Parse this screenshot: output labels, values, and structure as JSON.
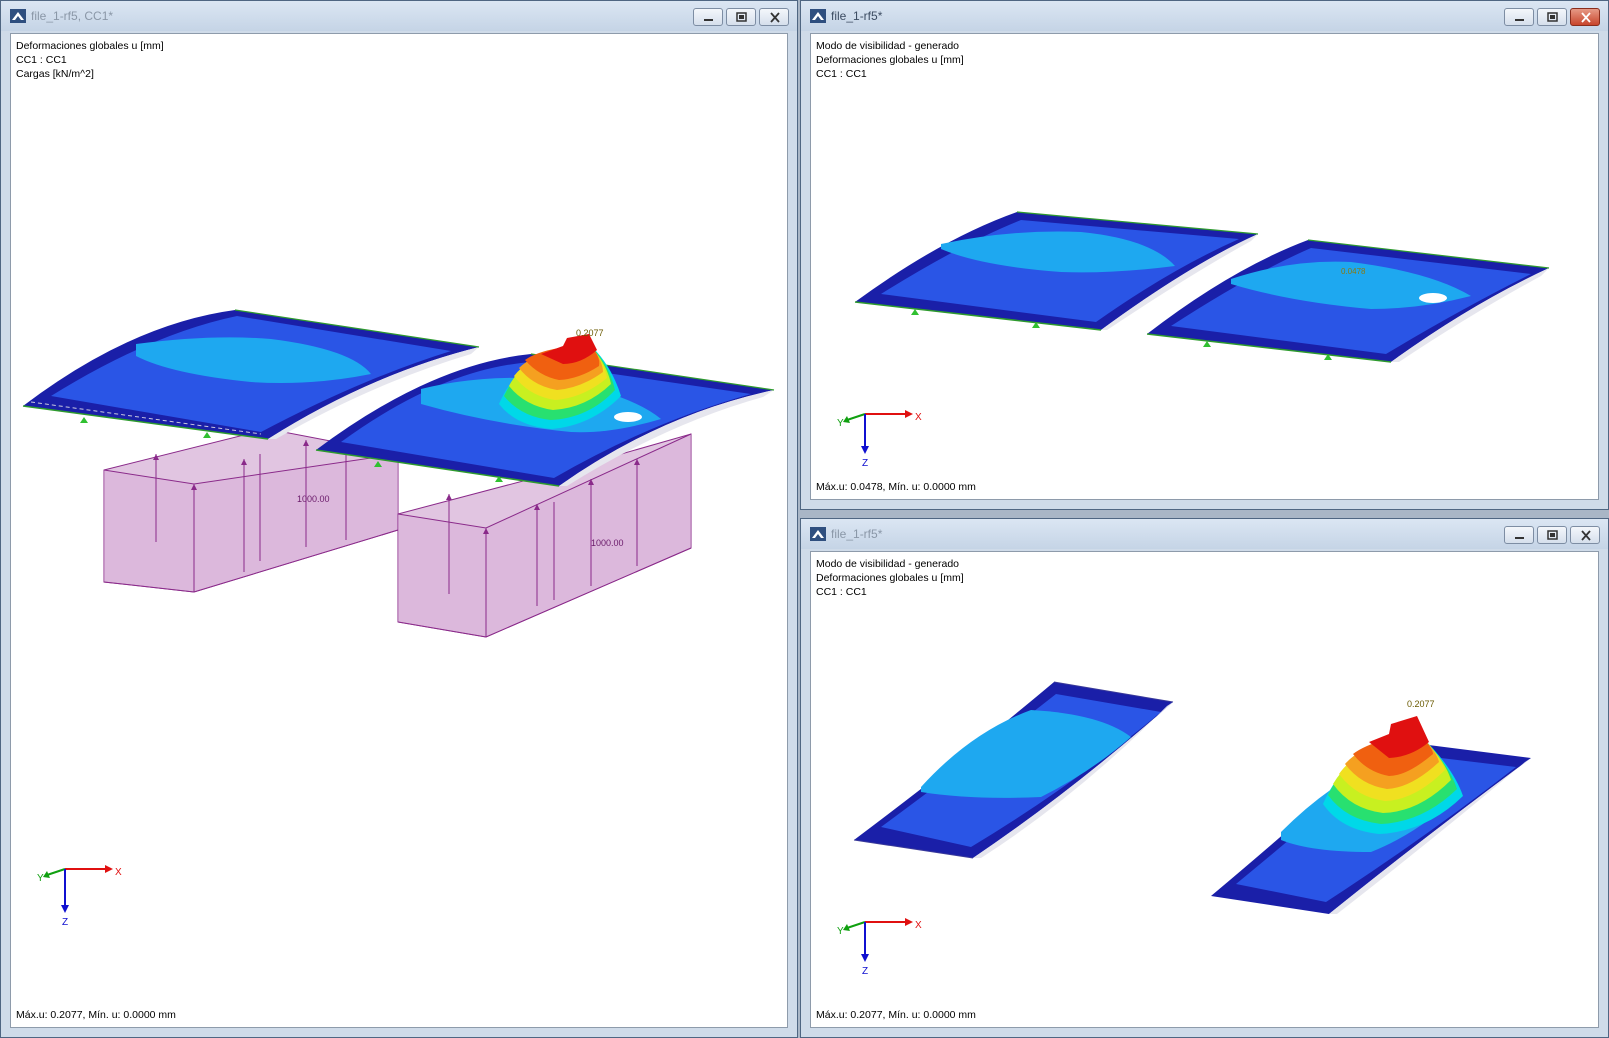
{
  "windows": {
    "main": {
      "title": "file_1-rf5, CC1*",
      "info": [
        "Deformaciones globales u [mm]",
        "CC1 : CC1",
        "Cargas [kN/m^2]"
      ],
      "status": "Máx.u: 0.2077, Mín. u: 0.0000 mm",
      "max_label": "0.2077",
      "load_labels": [
        "1000.00",
        "1000.00"
      ]
    },
    "top_right": {
      "title": "file_1-rf5*",
      "info": [
        "Modo de visibilidad - generado",
        "Deformaciones globales u [mm]",
        "CC1 : CC1"
      ],
      "status": "Máx.u: 0.0478, Mín. u: 0.0000 mm",
      "max_label": "0.0478"
    },
    "bottom_right": {
      "title": "file_1-rf5*",
      "info": [
        "Modo de visibilidad - generado",
        "Deformaciones globales u [mm]",
        "CC1 : CC1"
      ],
      "status": "Máx.u: 0.2077, Mín. u: 0.0000 mm",
      "max_label": "0.2077"
    }
  },
  "axes": {
    "x": "X",
    "y": "Y",
    "z": "Z"
  },
  "icons": [
    "app-icon",
    "minimize-icon",
    "maximize-icon",
    "close-icon"
  ],
  "colors": {
    "dark_blue": "#1a1fa8",
    "mid_blue": "#2a55e6",
    "light_blue": "#1ea8f0",
    "load_fill": "#c996c9",
    "load_line": "#8a2a8a",
    "axis_x": "#e01010",
    "axis_y": "#10a010",
    "axis_z": "#1010d0"
  }
}
